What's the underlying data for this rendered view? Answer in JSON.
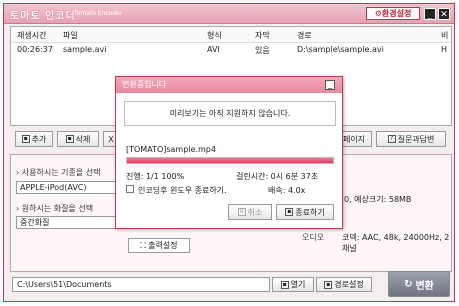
{
  "app": {
    "title": "토마토 인코더",
    "subtitle": "Tomato Encoder",
    "settings_label": "환경설정",
    "minimize": "_",
    "close": "✕"
  },
  "grid": {
    "headers": {
      "time": "재생시간",
      "file": "파일",
      "format": "형식",
      "subtitle": "자막",
      "path": "경로",
      "extra": "비"
    },
    "rows": [
      {
        "time": "00:26:37",
        "file": "sample.avi",
        "format": "AVI",
        "subtitle": "있음",
        "path": "D:\\sample\\sample.avi",
        "extra": "H"
      }
    ]
  },
  "toolbar": {
    "add": "추가",
    "delete": "삭제",
    "other": "X",
    "page": "페이지",
    "faq": "질문과답변"
  },
  "lower": {
    "device_label": "사용하시는 기종을 선택",
    "device_value": "APPLE-iPod(AVC)",
    "quality_label": "원하시는 화질을 선택",
    "quality_value": "중간화질",
    "output_settings": "출력설정",
    "size_info": "0, 예상크기: 58MB",
    "audio_tag": "오디오",
    "audio_info": "코덱: AAC, 48k, 24000Hz, 2 채널"
  },
  "bottom": {
    "path": "C:\\Users\\51\\Documents",
    "open": "열기",
    "path_settings": "경로설정",
    "convert": "변환"
  },
  "dialog": {
    "title": "변환중입니다",
    "minimize": "_",
    "preview_msg": "미리보기는 아직 지원하지 않습니다.",
    "filename": "[TOMATO]sample.mp4",
    "progress_percent": 100,
    "progress_text": "진행: 1/1 100%",
    "elapsed": "걸린시간: 0시 6분 37초",
    "shutdown": "인코딩후 윈도우 종료하기.",
    "speed": "배속: 4.0x",
    "cancel": "취소",
    "close_btn": "종료하기"
  },
  "colors": {
    "accent": "#e13d5f",
    "titlebar": "#e7a2b2"
  }
}
